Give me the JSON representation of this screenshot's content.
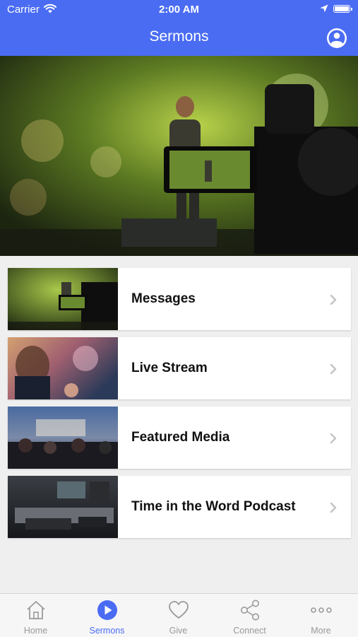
{
  "status_bar": {
    "carrier": "Carrier",
    "time": "2:00 AM"
  },
  "header": {
    "title": "Sermons"
  },
  "colors": {
    "accent": "#4a6cf3",
    "tab_inactive": "#999999"
  },
  "items": [
    {
      "label": "Messages"
    },
    {
      "label": "Live Stream"
    },
    {
      "label": "Featured Media"
    },
    {
      "label": "Time in the Word Podcast"
    }
  ],
  "tabs": [
    {
      "label": "Home",
      "icon": "home-icon"
    },
    {
      "label": "Sermons",
      "icon": "play-icon",
      "active": true
    },
    {
      "label": "Give",
      "icon": "heart-icon"
    },
    {
      "label": "Connect",
      "icon": "share-icon"
    },
    {
      "label": "More",
      "icon": "more-icon"
    }
  ]
}
